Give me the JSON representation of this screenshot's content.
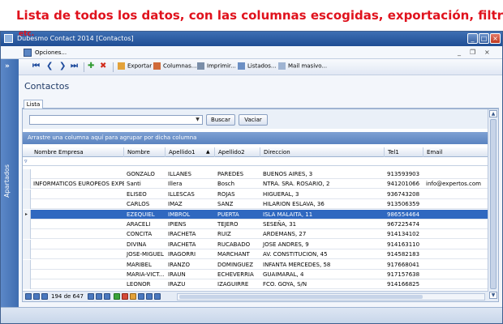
{
  "banner": {
    "text": "Lista de todos los datos, con las columnas escogidas, exportación, filtros,",
    "overlay": "etc."
  },
  "window": {
    "title": "Dubesmo Contact 2014 [Contactos]",
    "minimize": "_",
    "maximize": "□",
    "close": "×"
  },
  "menubar": {
    "opciones": "Opciones...",
    "mdi_min": "_",
    "mdi_restore": "❐",
    "mdi_close": "×"
  },
  "sidebar": {
    "toggle": "»",
    "label": "Apartados"
  },
  "toolbar": {
    "first": "⏮",
    "prev": "❮",
    "next": "❯",
    "last": "⏭",
    "add": "✚",
    "delete": "✖",
    "export": "Exportar",
    "columns": "Columnas...",
    "print": "Imprimir...",
    "listings": "Listados...",
    "mail": "Mail masivo..."
  },
  "page": {
    "heading": "Contactos",
    "tab": "Lista"
  },
  "search": {
    "buscar": "Buscar",
    "vaciar": "Vaciar"
  },
  "groupbar": {
    "text": "Arrastre una columna aquí para agrupar por dicha columna"
  },
  "grid": {
    "columns": [
      "Nombre Empresa",
      "Nombre",
      "Apellido1",
      "Apellido2",
      "Direccion",
      "Tel1",
      "Email"
    ],
    "sort_indicator": "▲",
    "rows": [
      [
        "",
        "GONZALO",
        "ILLANES",
        "PAREDES",
        "BUENOS AIRES, 3",
        "913593903",
        ""
      ],
      [
        "INFORMATICOS EUROPEOS EXPE...",
        "Santi",
        "Illera",
        "Bosch",
        "NTRA. SRA. ROSARIO, 2",
        "941201066",
        "info@expertos.com"
      ],
      [
        "",
        "ELISEO",
        "ILLESCAS",
        "ROJAS",
        "HIGUERAL, 3",
        "936743208",
        ""
      ],
      [
        "",
        "CARLOS",
        "IMAZ",
        "SANZ",
        "HILARION ESLAVA, 36",
        "913506359",
        ""
      ],
      [
        "",
        "EZEQUIEL",
        "IMBROL",
        "PUERTA",
        "ISLA MALAITA, 11",
        "986554464",
        ""
      ],
      [
        "",
        "ARACELI",
        "IPIENS",
        "TEJERO",
        "SESEÑA, 31",
        "967225474",
        ""
      ],
      [
        "",
        "CONCITA",
        "IRACHETA",
        "RUIZ",
        "ARDEMANS, 27",
        "914134102",
        ""
      ],
      [
        "",
        "DIVINA",
        "IRACHETA",
        "RUCABADO",
        "JOSE ANDRES, 9",
        "914163110",
        ""
      ],
      [
        "",
        "JOSE-MIGUEL",
        "IRAGORRI",
        "MARCHANT",
        "AV. CONSTITUCION, 45",
        "914582183",
        ""
      ],
      [
        "",
        "MARIBEL",
        "IRANZO",
        "DOMINGUEZ",
        "INFANTA MERCEDES, 58",
        "917668041",
        ""
      ],
      [
        "",
        "MARIA-VICT...",
        "IRAUN",
        "ECHEVERRIA",
        "GUAIMARAL, 4",
        "917157638",
        ""
      ],
      [
        "",
        "LEONOR",
        "IRAZU",
        "IZAGUIRRE",
        "FCO. GOYA, S/N",
        "914166825",
        ""
      ]
    ],
    "selected_index": 4,
    "selected_marker": "▸",
    "filter_icon": "▿"
  },
  "navigator": {
    "position": "194 de 647"
  },
  "colors": {
    "banner_red": "#e0121d",
    "selection_blue": "#2f68c0",
    "titlebar_blue": "#1f4d94"
  }
}
